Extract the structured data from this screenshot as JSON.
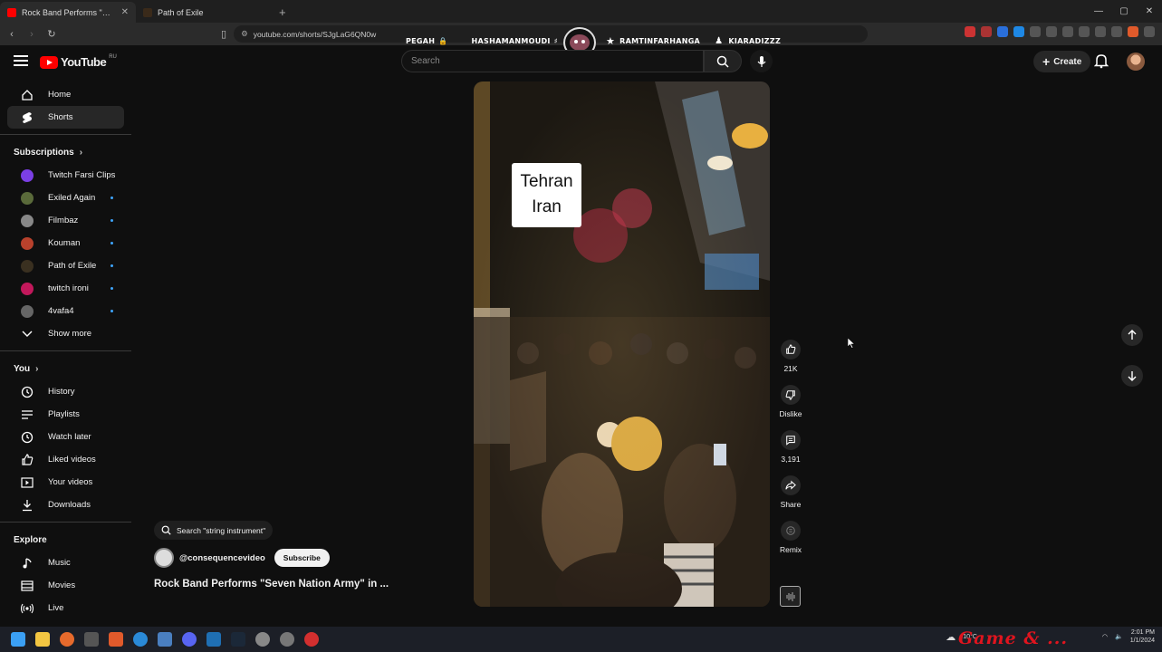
{
  "browser": {
    "tabs": [
      {
        "label": "Rock Band Performs \"Seven N",
        "active": true,
        "favicon_color": "#ff0000"
      },
      {
        "label": "Path of Exile",
        "active": false,
        "favicon_color": "#3a2a1a"
      }
    ],
    "new_tab": "+",
    "url": "youtube.com/shorts/SJgLaG6QN0w"
  },
  "overlay": {
    "left_names": [
      "PEGAH",
      "HASHAMANMOUDI"
    ],
    "right_names": [
      "RAMTINFARHANGA",
      "KIARADIZZZ"
    ]
  },
  "header": {
    "logo_text": "YouTube",
    "region": "RU",
    "search_placeholder": "Search",
    "create_label": "Create"
  },
  "sidebar": {
    "main": [
      {
        "label": "Home",
        "icon": "home-icon",
        "active": false
      },
      {
        "label": "Shorts",
        "icon": "shorts-icon",
        "active": true
      }
    ],
    "subscriptions_title": "Subscriptions",
    "subscriptions": [
      {
        "label": "Twitch Farsi Clips",
        "color": "#7b3fe4",
        "new": false
      },
      {
        "label": "Exiled Again",
        "color": "#5a6a3a",
        "new": true
      },
      {
        "label": "Filmbaz",
        "color": "#888888",
        "new": true
      },
      {
        "label": "Kouman",
        "color": "#b8412c",
        "new": true
      },
      {
        "label": "Path of Exile",
        "color": "#3a3020",
        "new": true
      },
      {
        "label": "twitch ironi",
        "color": "#c2185b",
        "new": true
      },
      {
        "label": "4vafa4",
        "color": "#666666",
        "new": true
      }
    ],
    "show_more": "Show more",
    "you_title": "You",
    "you": [
      {
        "label": "History",
        "icon": "history-icon"
      },
      {
        "label": "Playlists",
        "icon": "playlists-icon"
      },
      {
        "label": "Watch later",
        "icon": "watch-later-icon"
      },
      {
        "label": "Liked videos",
        "icon": "like-icon"
      },
      {
        "label": "Your videos",
        "icon": "your-videos-icon"
      },
      {
        "label": "Downloads",
        "icon": "download-icon"
      }
    ],
    "explore_title": "Explore",
    "explore": [
      {
        "label": "Music",
        "icon": "music-icon"
      },
      {
        "label": "Movies",
        "icon": "movies-icon"
      },
      {
        "label": "Live",
        "icon": "live-icon"
      }
    ]
  },
  "short": {
    "caption_line1": "Tehran",
    "caption_line2": "Iran",
    "search_chip": "Search \"string instrument\"",
    "channel_handle": "@consequencevideo",
    "subscribe_label": "Subscribe",
    "title": "Rock Band Performs \"Seven Nation Army\" in ...",
    "actions": {
      "likes": "21K",
      "dislike": "Dislike",
      "comments": "3,191",
      "share": "Share",
      "remix": "Remix"
    }
  },
  "taskbar": {
    "watermark": "Game & ...",
    "weather": "10°C",
    "clock_time": "2:01 PM",
    "clock_date": "1/1/2024"
  }
}
